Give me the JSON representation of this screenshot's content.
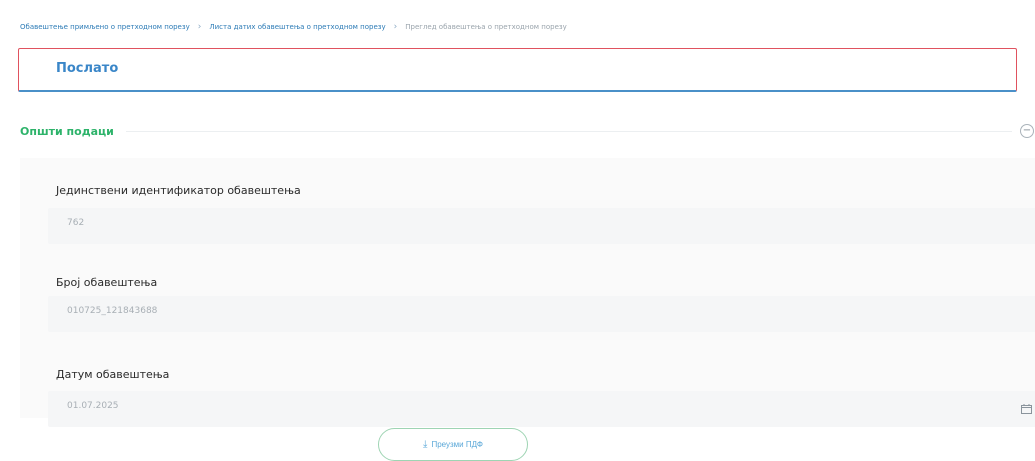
{
  "breadcrumb": {
    "items": [
      "Обавештење примљено о претходном порезу",
      "Листа датих обавештења о претходном порезу",
      "Преглед обавештења о претходном порезу"
    ]
  },
  "status": {
    "label": "Послато"
  },
  "section": {
    "title": "Општи подаци"
  },
  "fields": [
    {
      "label": "Јединствени идентификатор обавештења",
      "value": "762"
    },
    {
      "label": "Број обавештења",
      "value": "010725_121843688"
    },
    {
      "label": "Датум обавештења",
      "value": "01.07.2025"
    }
  ],
  "actions": {
    "download_label": "Преузми ПДФ"
  },
  "icons": {
    "separator": "chevron-right-icon",
    "collapse": "minus-circle-icon",
    "calendar": "calendar-icon",
    "download": "download-icon"
  },
  "colors": {
    "accent_blue": "#3a86c8",
    "section_green": "#2db36a",
    "status_border": "#e0525f"
  }
}
